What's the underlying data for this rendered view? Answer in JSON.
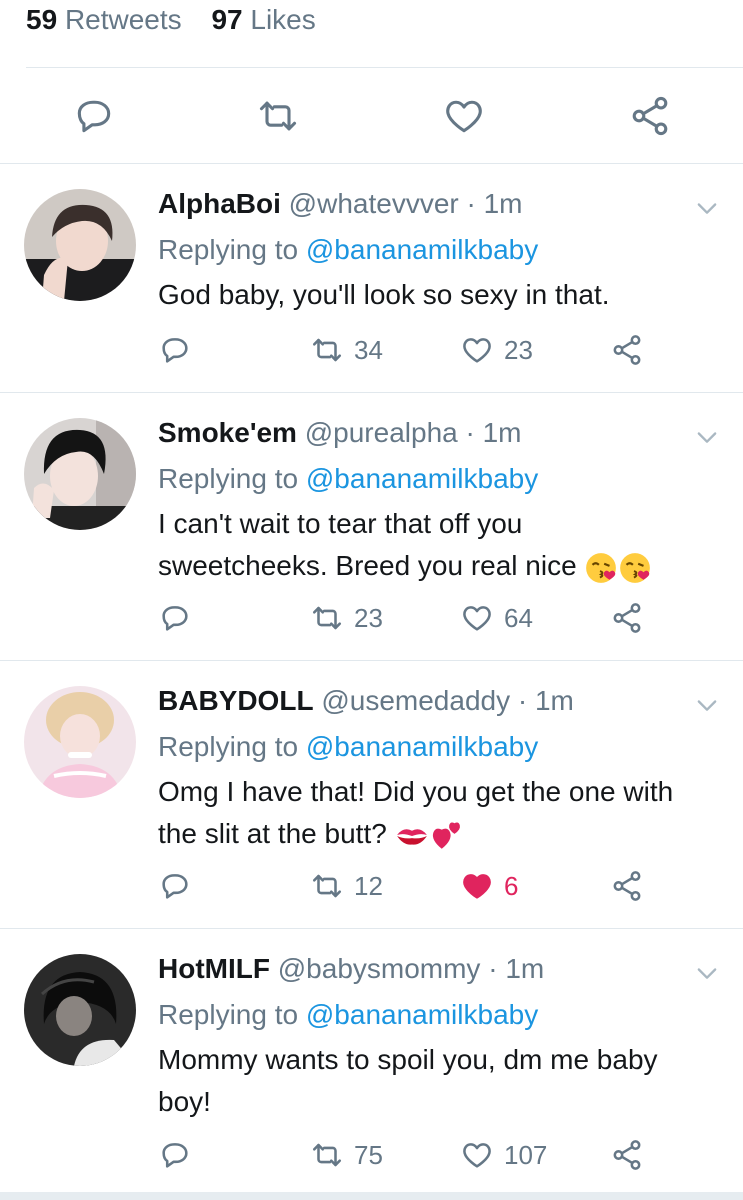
{
  "stats": {
    "retweets_count": "59",
    "retweets_label": "Retweets",
    "likes_count": "97",
    "likes_label": "Likes"
  },
  "colors": {
    "accent": "#1b95e0",
    "muted": "#657786",
    "like": "#e0245e",
    "divider": "#e1e8ed"
  },
  "main_actions": [
    {
      "icon": "reply-icon"
    },
    {
      "icon": "retweet-icon"
    },
    {
      "icon": "heart-icon"
    },
    {
      "icon": "share-icon"
    }
  ],
  "replies": [
    {
      "name": "AlphaBoi",
      "handle": "@whatevvver",
      "time": "· 1m",
      "replying_label": "Replying to",
      "replying_to": "@bananamilkbaby",
      "text_lines": [
        "God baby, you'll look so sexy in that."
      ],
      "retweets": "34",
      "likes": "23",
      "liked": false
    },
    {
      "name": "Smoke'em",
      "handle": "@purealpha",
      "time": "· 1m",
      "replying_label": "Replying to",
      "replying_to": "@bananamilkbaby",
      "text_lines": [
        "I can't wait to tear that off you",
        "sweetcheeks. Breed you real nice"
      ],
      "retweets": "23",
      "likes": "64",
      "liked": false
    },
    {
      "name": "BABYDOLL",
      "handle": "@usemedaddy",
      "time": "· 1m",
      "replying_label": "Replying to",
      "replying_to": "@bananamilkbaby",
      "text_lines": [
        "Omg I have that! Did you get the one with",
        "the slit at the butt?"
      ],
      "retweets": "12",
      "likes": "6",
      "liked": true
    },
    {
      "name": "HotMILF",
      "handle": "@babysmommy",
      "time": "· 1m",
      "replying_label": "Replying to",
      "replying_to": "@bananamilkbaby",
      "text_lines": [
        "Mommy wants to spoil you, dm me baby",
        "boy!"
      ],
      "retweets": "75",
      "likes": "107",
      "liked": false
    }
  ]
}
